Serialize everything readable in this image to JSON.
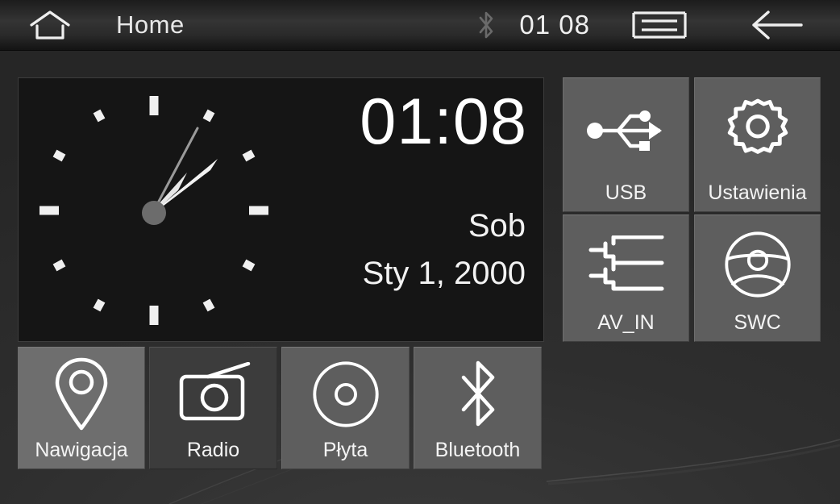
{
  "statusbar": {
    "home_icon": "home-icon",
    "title": "Home",
    "bluetooth_icon": "bluetooth-icon",
    "bluetooth_active": false,
    "clock": "01 08",
    "menu_icon": "menu-icon",
    "back_icon": "back-arrow-icon"
  },
  "clock_widget": {
    "analog_icon": "analog-clock",
    "hour_angle": 42,
    "minute_angle": 48,
    "second_angle": 28,
    "digital_time": "01:08",
    "day_name": "Sob",
    "date": "Sty 1, 2000"
  },
  "right_tiles": [
    {
      "id": "usb",
      "label": "USB",
      "icon": "usb-icon",
      "state": "normal"
    },
    {
      "id": "settings",
      "label": "Ustawienia",
      "icon": "gear-icon",
      "state": "normal"
    },
    {
      "id": "avin",
      "label": "AV_IN",
      "icon": "av-input-icon",
      "state": "normal"
    },
    {
      "id": "swc",
      "label": "SWC",
      "icon": "steering-wheel-icon",
      "state": "normal"
    }
  ],
  "bottom_tiles": [
    {
      "id": "nav",
      "label": "Nawigacja",
      "icon": "map-pin-icon",
      "state": "highlighted"
    },
    {
      "id": "radio",
      "label": "Radio",
      "icon": "radio-icon",
      "state": "dark"
    },
    {
      "id": "disc",
      "label": "Płyta",
      "icon": "disc-icon",
      "state": "normal"
    },
    {
      "id": "bt",
      "label": "Bluetooth",
      "icon": "bluetooth-icon",
      "state": "normal"
    }
  ],
  "colors": {
    "tile_normal": "#5e5e5e",
    "tile_dark": "#3c3c3c",
    "tile_highlight": "#6e6e6e",
    "card_background": "#151515",
    "screen_background": "#2b2b2b",
    "text": "#f4f4f4",
    "statusbar_bluetooth_inactive": "#6a6a6a"
  }
}
